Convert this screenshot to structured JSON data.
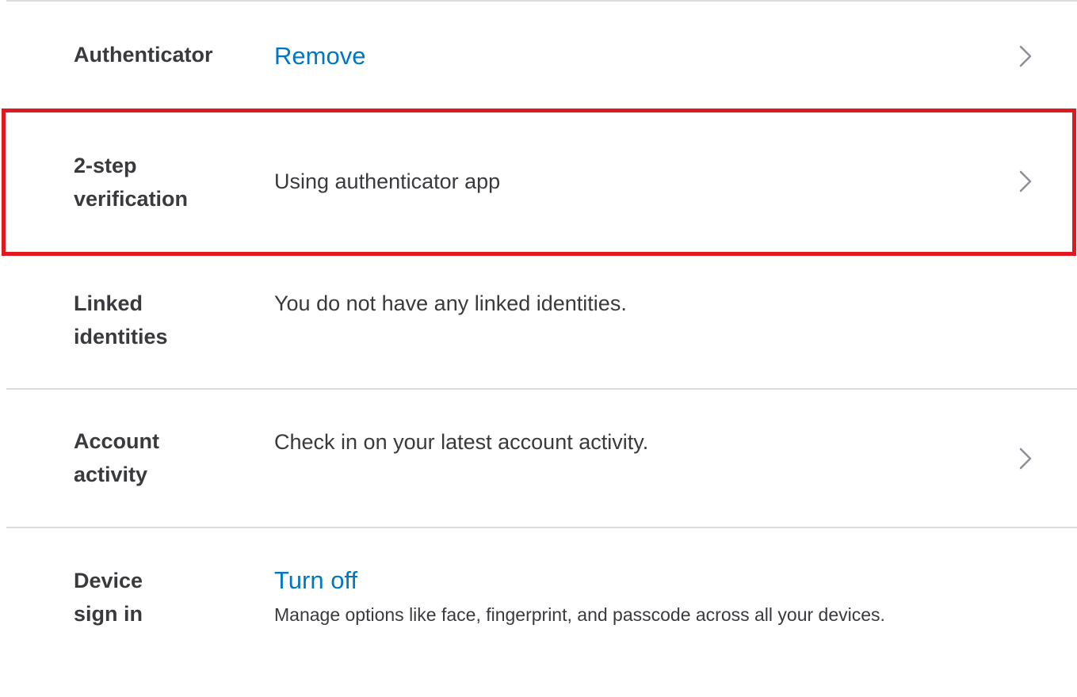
{
  "rows": [
    {
      "label_lines": [
        "Authenticator"
      ],
      "link": "Remove",
      "value": "",
      "chevron": true
    },
    {
      "label_lines": [
        "2-step",
        "verification"
      ],
      "value": "Using authenticator app",
      "chevron": true,
      "highlighted": true
    },
    {
      "label_lines": [
        "Linked",
        "identities"
      ],
      "value": "You do not have any linked identities.",
      "chevron": false
    },
    {
      "label_lines": [
        "Account",
        "activity"
      ],
      "value": "Check in on your latest account activity.",
      "chevron": true
    },
    {
      "label_lines": [
        "Device",
        "sign in"
      ],
      "link": "Turn off",
      "description": "Manage options like face, fingerprint, and passcode across all your devices.",
      "chevron": false
    }
  ],
  "colors": {
    "link": "#0077c5",
    "text": "#393a3d",
    "divider": "#dcdcdc",
    "highlight": "#e0181f",
    "chevron": "#8d9096"
  },
  "icons": {
    "chevron": "chevron-right-icon"
  }
}
